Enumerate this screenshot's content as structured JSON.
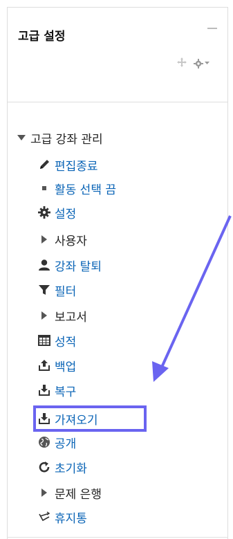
{
  "block": {
    "title": "고급 설정",
    "collapse_icon": "minus-icon",
    "move_icon": "move-icon",
    "actions_icon": "gear-icon"
  },
  "tree": {
    "root_label": "고급 강좌 관리",
    "items": [
      {
        "label": "편집종료",
        "icon": "pencil-icon"
      },
      {
        "label": "활동 선택 끔",
        "icon": "bullet-icon"
      },
      {
        "label": "설정",
        "icon": "gear-icon"
      },
      {
        "label": "사용자",
        "icon": "caret-right-icon"
      },
      {
        "label": "강좌 탈퇴",
        "icon": "user-icon"
      },
      {
        "label": "필터",
        "icon": "filter-icon"
      },
      {
        "label": "보고서",
        "icon": "caret-right-icon"
      },
      {
        "label": "성적",
        "icon": "table-icon"
      },
      {
        "label": "백업",
        "icon": "upload-icon"
      },
      {
        "label": "복구",
        "icon": "download-icon"
      },
      {
        "label": "가져오기",
        "icon": "import-icon"
      },
      {
        "label": "공개",
        "icon": "globe-icon"
      },
      {
        "label": "초기화",
        "icon": "refresh-icon"
      },
      {
        "label": "문제 은행",
        "icon": "caret-right-icon"
      },
      {
        "label": "휴지통",
        "icon": "trash-icon"
      }
    ]
  },
  "annotation": {
    "highlight_color": "#6a64f0",
    "arrow_color": "#6a64f0"
  }
}
